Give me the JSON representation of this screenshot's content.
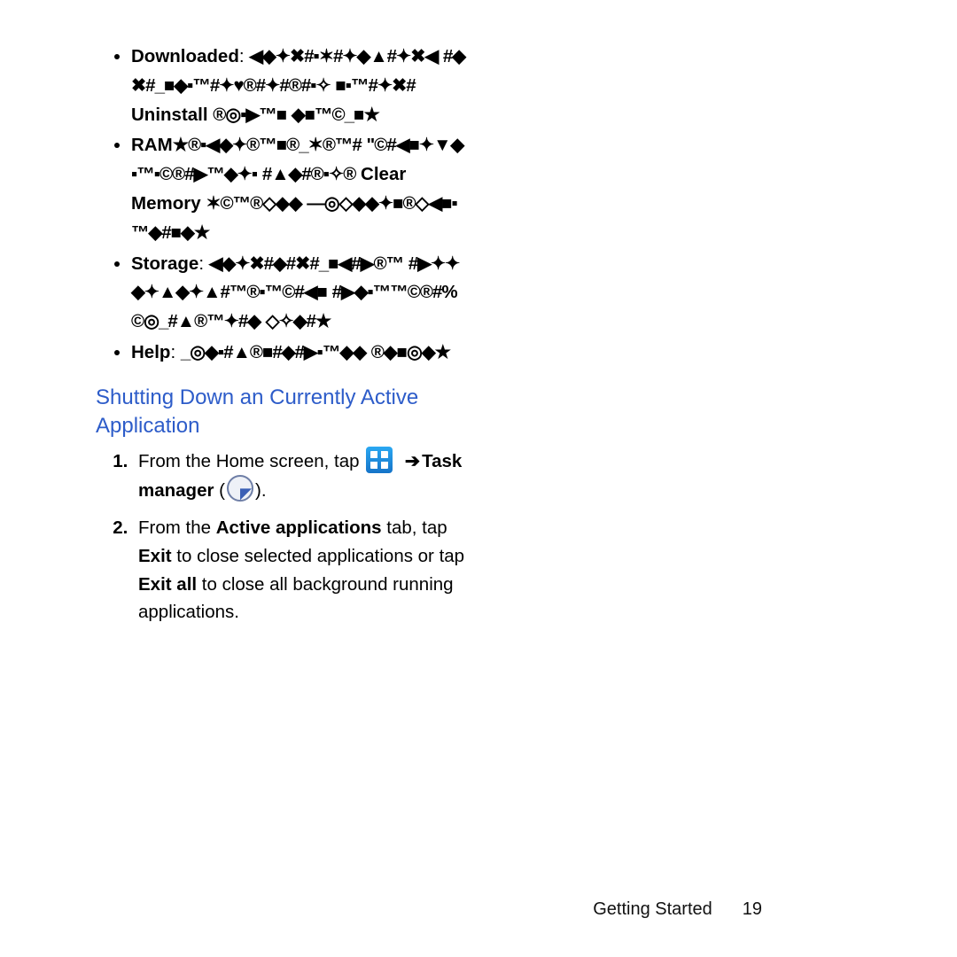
{
  "tabs": {
    "downloaded": {
      "label": "Downloaded",
      "g1": "◀◆✦✖#▪✶#✦◆▲#✦✖◀",
      "g2": "#◆✖#_■◆▪™#✦♥®#✦#®#▪✧",
      "g3": "■▪™#✦✖#",
      "action": "Uninstall",
      "g4": "®◎▪▶™■",
      "g5": "◆■™©_■★"
    },
    "ram": {
      "label": "RAM",
      "g1": "★®▪◀◆✦®™■®_✶®™#",
      "g2": "\"©#◀■✦▼◆▪™▪©®#▶™◆✦▪",
      "g3": "#▲◆#®▪✧®",
      "action": "Clear Memory",
      "g4": "✶©™®◇◆◆",
      "g5": "—◎◇◆◆✦■®◇◀■▪™◆#■◆★"
    },
    "storage": {
      "label": "Storage",
      "g1": "◀◆✦✖#◆#✖#_■◀#▶®™",
      "g2": "#▶✦✦◆✦▲◆✦▲#™®▪™©#◀■",
      "g3": "#▶◆▪™™©®#%©◎_#▲®™✦#◆",
      "g4": "◇✧◆#★"
    },
    "help": {
      "label": "Help",
      "g1": "_◎◆▪#▲®■#◆#▶▪™◆◆",
      "g2": "®◆■◎◆★"
    }
  },
  "heading": "Shutting Down an Currently Active Application",
  "steps": {
    "s1_a": "From the Home screen, tap",
    "s1_arrow": "➔",
    "s1_b": "Task manager",
    "s1_open": " (",
    "s1_close": ").",
    "s2_a": "From the ",
    "s2_b": "Active applications",
    "s2_c": " tab, tap ",
    "s2_d": "Exit",
    "s2_e": " to close selected applications or tap ",
    "s2_f": "Exit all",
    "s2_g": " to close all background running applications."
  },
  "footer": {
    "section": "Getting Started",
    "page": "19"
  }
}
